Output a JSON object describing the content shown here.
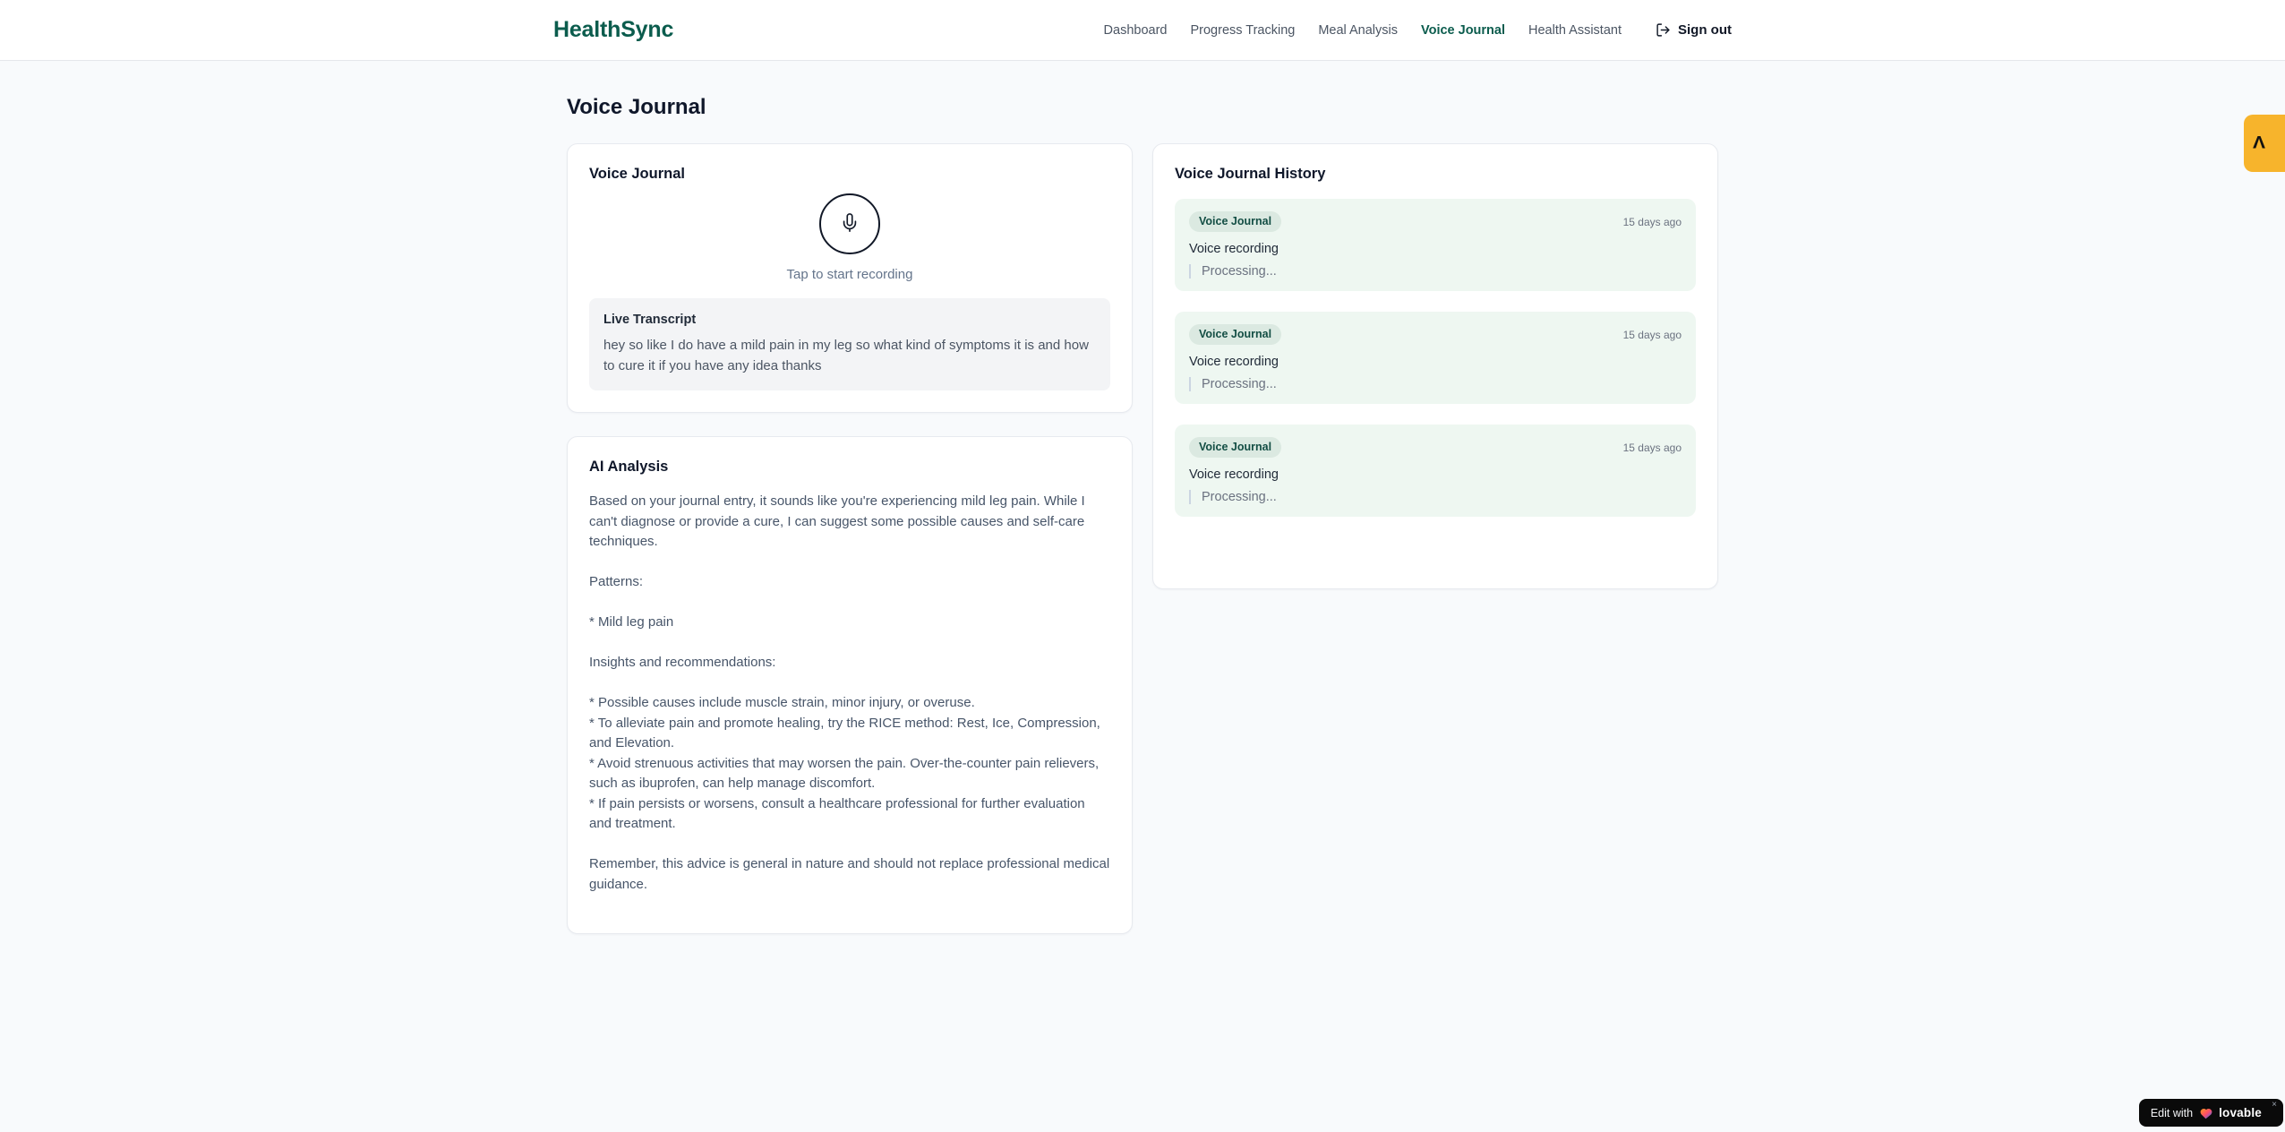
{
  "app": {
    "name": "HealthSync"
  },
  "colors": {
    "brand_green": "#0b5c4d",
    "page_bg": "#f8fafc",
    "history_item_bg": "#eef7f1",
    "badge_bg": "#dbe9e1",
    "badge_text": "#134e44",
    "amber_tag": "#f7b42c",
    "pill_bg": "#0a0a0a"
  },
  "nav": {
    "items": [
      {
        "label": "Dashboard",
        "active": false
      },
      {
        "label": "Progress Tracking",
        "active": false
      },
      {
        "label": "Meal Analysis",
        "active": false
      },
      {
        "label": "Voice Journal",
        "active": true
      },
      {
        "label": "Health Assistant",
        "active": false
      }
    ],
    "sign_out_label": "Sign out"
  },
  "page": {
    "title": "Voice Journal"
  },
  "recorder_card": {
    "title": "Voice Journal",
    "tap_hint": "Tap to start recording",
    "transcript_title": "Live Transcript",
    "transcript_text": "hey so like I do have a mild pain in my leg so what kind of symptoms it is and how to cure it if you have any idea thanks"
  },
  "analysis_card": {
    "title": "AI Analysis",
    "body": "Based on your journal entry, it sounds like you're experiencing mild leg pain. While I can't diagnose or provide a cure, I can suggest some possible causes and self-care techniques.\n\nPatterns:\n\n* Mild leg pain\n\nInsights and recommendations:\n\n* Possible causes include muscle strain, minor injury, or overuse.\n* To alleviate pain and promote healing, try the RICE method: Rest, Ice, Compression, and Elevation.\n* Avoid strenuous activities that may worsen the pain. Over-the-counter pain relievers, such as ibuprofen, can help manage discomfort.\n* If pain persists or worsens, consult a healthcare professional for further evaluation and treatment.\n\nRemember, this advice is general in nature and should not replace professional medical guidance."
  },
  "history_card": {
    "title": "Voice Journal History",
    "entries": [
      {
        "badge": "Voice Journal",
        "time": "15 days ago",
        "label": "Voice recording",
        "status": "Processing..."
      },
      {
        "badge": "Voice Journal",
        "time": "15 days ago",
        "label": "Voice recording",
        "status": "Processing..."
      },
      {
        "badge": "Voice Journal",
        "time": "15 days ago",
        "label": "Voice recording",
        "status": "Processing..."
      }
    ]
  },
  "side_tag": {
    "glyph": "Λ"
  },
  "lovable_badge": {
    "prefix": "Edit with",
    "brand": "lovable",
    "close": "×"
  }
}
